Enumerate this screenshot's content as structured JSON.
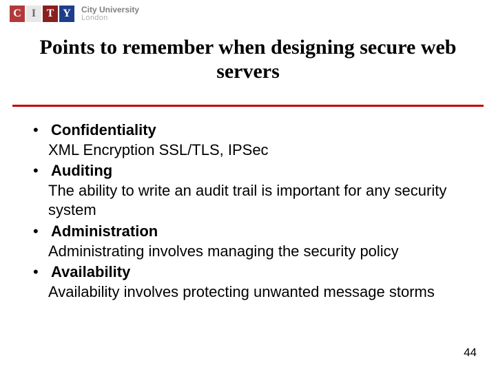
{
  "logo": {
    "tiles": [
      "C",
      "I",
      "T",
      "Y"
    ],
    "text_top": "City University",
    "text_bottom": "London"
  },
  "title": "Points to remember when designing secure web servers",
  "bullets": [
    {
      "heading": "Confidentiality",
      "desc": "XML Encryption SSL/TLS, IPSec"
    },
    {
      "heading": "Auditing",
      "desc": "The ability to write an audit trail is important for any security system"
    },
    {
      "heading": "Administration",
      "desc": "Administrating involves managing the security policy"
    },
    {
      "heading": "Availability",
      "desc": "Availability involves protecting unwanted message storms"
    }
  ],
  "page_number": "44",
  "bullet_char": "•"
}
